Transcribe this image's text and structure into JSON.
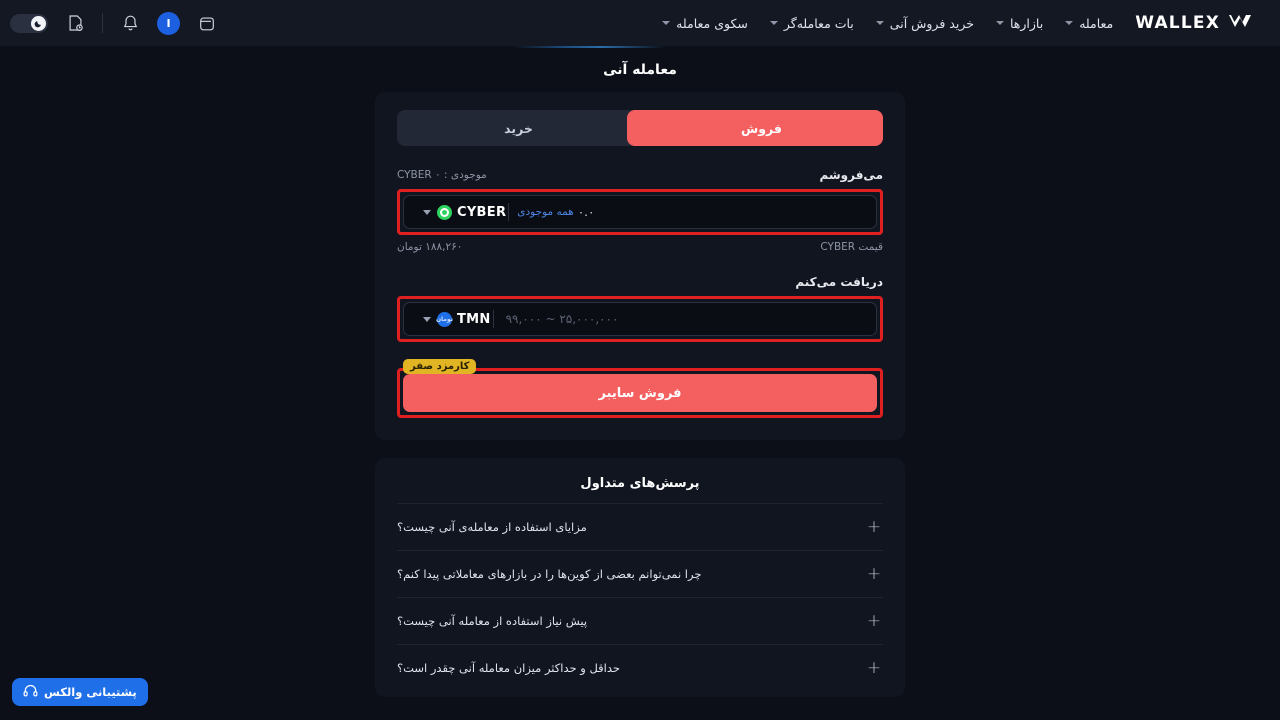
{
  "brand": {
    "name": "WALLEX"
  },
  "nav": {
    "items": [
      {
        "label": "معامله",
        "has_caret": true
      },
      {
        "label": "بازارها",
        "has_caret": true
      },
      {
        "label": "خرید فروش آنی",
        "has_caret": true
      },
      {
        "label": "بات معامله‌گر",
        "has_caret": true
      },
      {
        "label": "سکوی معامله",
        "has_caret": true
      }
    ],
    "icons": {
      "theme_toggle": "moon-icon",
      "orders": "document-clock-icon",
      "notifications": "bell-icon",
      "profile_initial": "I",
      "wallet": "wallet-icon"
    }
  },
  "page": {
    "title": "معامله آنی"
  },
  "switch": {
    "sell_label": "فروش",
    "buy_label": "خرید",
    "active": "sell",
    "active_color": "#f4605f"
  },
  "sell_field": {
    "label": "می‌فروشم",
    "balance_text": "موجودی  :  ۰ CYBER",
    "value": "۰.۰",
    "max_link": "همه موجودی",
    "coin": "CYBER",
    "coin_icon": "cyber-coin-icon",
    "price_label": "قیمت CYBER",
    "price_value": "۱۸۸,۲۶۰ تومان"
  },
  "receive_field": {
    "label": "دریافت می‌کنم",
    "placeholder": "۹۹,۰۰۰ ~ ۲۵,۰۰۰,۰۰۰",
    "value": "",
    "coin": "TMN",
    "coin_icon": "toman-coin-icon",
    "coin_icon_text": "تومان"
  },
  "action": {
    "label": "فروش سایبر",
    "fee_badge": "کارمزد صفر",
    "badge_color": "#e0b423"
  },
  "faq": {
    "title": "پرسش‌های متداول",
    "items": [
      {
        "question": "مزایای استفاده از معامله‌ی آنی چیست؟",
        "toggle": "+"
      },
      {
        "question": "چرا نمی‌توانم بعضی از کوین‌ها را در بازارهای معاملاتی پیدا کنم؟",
        "toggle": "+"
      },
      {
        "question": "پیش نیاز استفاده از معامله آنی چیست؟",
        "toggle": "+"
      },
      {
        "question": "حداقل و حداکثر میزان معامله آنی چقدر است؟",
        "toggle": "+"
      }
    ]
  },
  "support": {
    "label": "پشتیبانی والکس",
    "icon": "headset-icon",
    "color": "#1f6fe8"
  }
}
